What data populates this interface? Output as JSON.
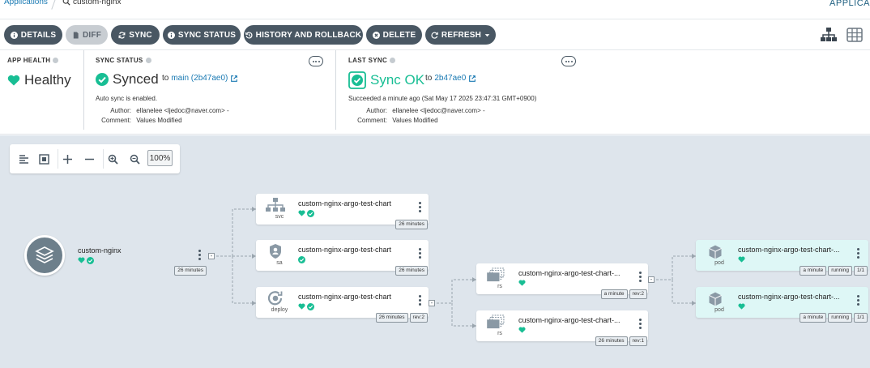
{
  "breadcrumb": {
    "root": "Applications",
    "current": "custom-nginx",
    "right": "APPLICA"
  },
  "toolbar": {
    "details": "DETAILS",
    "diff": "DIFF",
    "sync": "SYNC",
    "sync_status": "SYNC STATUS",
    "history": "HISTORY AND ROLLBACK",
    "delete": "DELETE",
    "refresh": "REFRESH"
  },
  "app_health": {
    "label": "APP HEALTH",
    "value": "Healthy"
  },
  "sync_status": {
    "label": "SYNC STATUS",
    "value": "Synced",
    "to": "to",
    "rev": "main (2b47ae0)",
    "note": "Auto sync is enabled.",
    "author_key": "Author:",
    "author": "ellanelee <ljedoc@naver.com> -",
    "comment_key": "Comment:",
    "comment": "Values Modified"
  },
  "last_sync": {
    "label": "LAST SYNC",
    "value": "Sync OK",
    "to": "to",
    "rev": "2b47ae0",
    "note": "Succeeded a minute ago (Sat May 17 2025 23:47:31 GMT+0900)",
    "author_key": "Author:",
    "author": "ellanelee <ljedoc@naver.com> -",
    "comment_key": "Comment:",
    "comment": "Values Modified"
  },
  "zoom": {
    "level": "100%"
  },
  "colors": {
    "healthy": "#18be94",
    "button": "#495763",
    "canvas": "#dee5ec",
    "pod_bg": "#def7f6"
  },
  "nodes": {
    "app": {
      "name": "custom-nginx",
      "age": "26 minutes"
    },
    "svc": {
      "name": "custom-nginx-argo-test-chart",
      "kind": "svc",
      "age": "26 minutes"
    },
    "sa": {
      "name": "custom-nginx-argo-test-chart",
      "kind": "sa",
      "age": "26 minutes"
    },
    "deploy": {
      "name": "custom-nginx-argo-test-chart",
      "kind": "deploy",
      "age": "26 minutes",
      "rev": "rev:2"
    },
    "rs1": {
      "name": "custom-nginx-argo-test-chart-...",
      "kind": "rs",
      "age": "a minute",
      "rev": "rev:2"
    },
    "rs2": {
      "name": "custom-nginx-argo-test-chart-...",
      "kind": "rs",
      "age": "26 minutes",
      "rev": "rev:1"
    },
    "pod1": {
      "name": "custom-nginx-argo-test-chart-...",
      "kind": "pod",
      "age": "a minute",
      "state": "running",
      "count": "1/1"
    },
    "pod2": {
      "name": "custom-nginx-argo-test-chart-...",
      "kind": "pod",
      "age": "a minute",
      "state": "running",
      "count": "1/1"
    }
  }
}
